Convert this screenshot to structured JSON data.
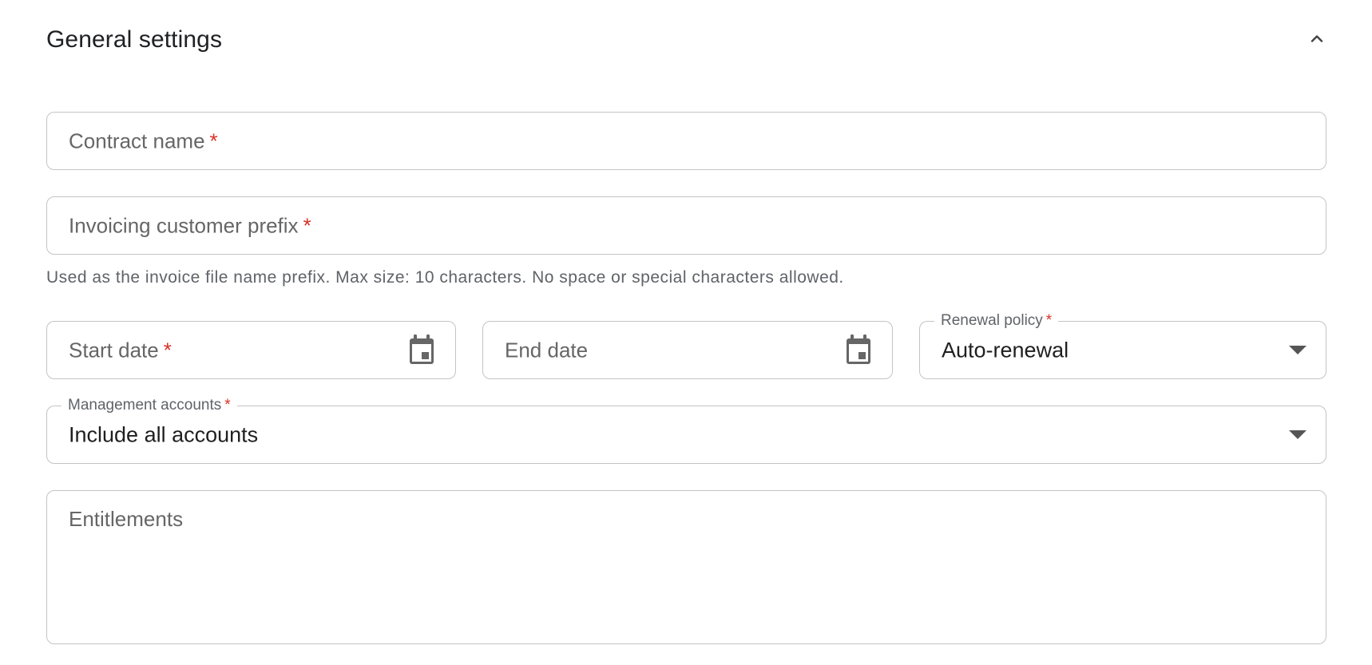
{
  "section": {
    "title": "General settings",
    "collapse_icon": "chevron-up-icon"
  },
  "fields": {
    "contract_name": {
      "label": "Contract name",
      "required_mark": "*"
    },
    "invoicing_prefix": {
      "label": "Invoicing customer prefix",
      "required_mark": "*",
      "helper": "Used as the invoice file name prefix. Max size: 10 characters. No space or special characters allowed."
    },
    "start_date": {
      "label": "Start date",
      "required_mark": "*",
      "icon": "calendar-icon"
    },
    "end_date": {
      "label": "End date",
      "icon": "calendar-icon"
    },
    "renewal_policy": {
      "label": "Renewal policy",
      "required_mark": "*",
      "value": "Auto-renewal",
      "icon": "dropdown-arrow-icon"
    },
    "management_accounts": {
      "label": "Management accounts",
      "required_mark": "*",
      "value": "Include all accounts",
      "icon": "dropdown-arrow-icon"
    },
    "entitlements": {
      "label": "Entitlements"
    }
  },
  "colors": {
    "border": "#c4c4c4",
    "required": "#d93025",
    "label": "#666666",
    "text": "#1f1f1f"
  }
}
